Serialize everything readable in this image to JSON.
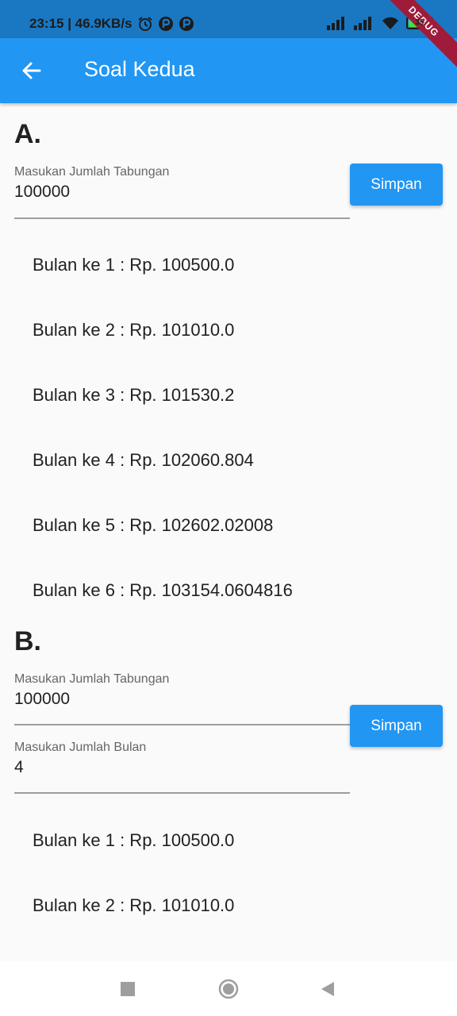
{
  "status_bar": {
    "time_speed": "23:15 | 46.9KB/s",
    "battery": "39",
    "icons": [
      "alarm-icon",
      "app-notification-icon",
      "app-notification-icon",
      "signal-icon",
      "signal-icon",
      "wifi-icon",
      "battery-icon"
    ],
    "battery_level": 0.39
  },
  "app_bar": {
    "title": "Soal Kedua",
    "back_icon": "arrow-back-icon"
  },
  "debug_banner": "DEBUG",
  "section_a": {
    "title": "A.",
    "field_label": "Masukan Jumlah Tabungan",
    "field_value": "100000",
    "button": "Simpan",
    "results": [
      "Bulan ke 1 : Rp. 100500.0",
      "Bulan ke 2 : Rp. 101010.0",
      "Bulan ke 3 : Rp. 101530.2",
      "Bulan ke 4 : Rp. 102060.804",
      "Bulan ke 5 : Rp. 102602.02008",
      "Bulan ke 6 : Rp. 103154.0604816"
    ]
  },
  "section_b": {
    "title": "B.",
    "field1_label": "Masukan Jumlah Tabungan",
    "field1_value": "100000",
    "field2_label": "Masukan Jumlah Bulan",
    "field2_value": "4",
    "button": "Simpan",
    "results": [
      "Bulan ke 1 : Rp. 100500.0",
      "Bulan ke 2 : Rp. 101010.0"
    ]
  },
  "colors": {
    "primary": "#2196f3",
    "status_bar": "#1a78c2",
    "debug": "#a01b3a"
  }
}
